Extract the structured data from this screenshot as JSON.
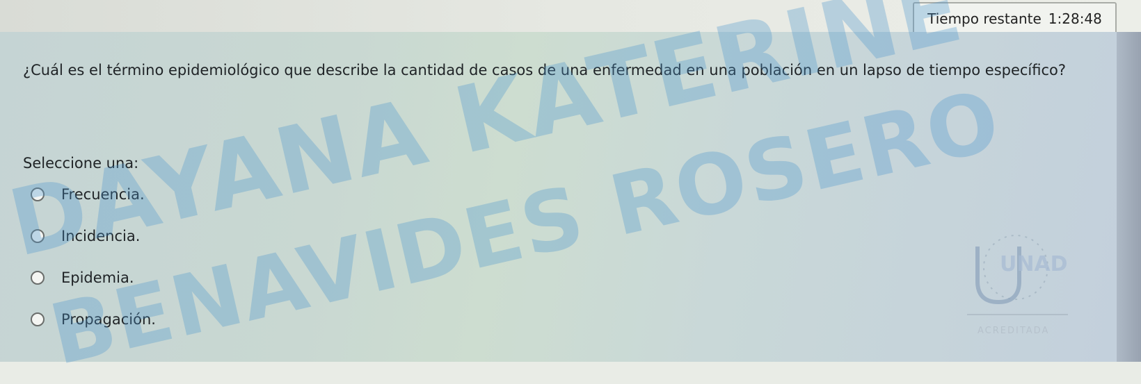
{
  "timer": {
    "label": "Tiempo restante",
    "value": "1:28:48"
  },
  "question": {
    "text": "¿Cuál es el término epidemiológico que describe la cantidad de casos de una enfermedad en una población en un lapso de tiempo específico?"
  },
  "prompt": "Seleccione una:",
  "options": [
    {
      "label": "Frecuencia."
    },
    {
      "label": "Incidencia."
    },
    {
      "label": "Epidemia."
    },
    {
      "label": "Propagación."
    }
  ],
  "watermark": {
    "line1": "DAYANA KATERINE",
    "line2": "BENAVIDES ROSERO"
  },
  "logo": {
    "text": "UNAD",
    "accreditation": "ACREDITADA"
  },
  "colors": {
    "watermark": "#4b96cd",
    "panel": "#c9d8d2",
    "radio_border": "#6a6d6b"
  },
  "icons": {
    "radio": "radio-button-unchecked-icon",
    "logo": "unad-logo-icon"
  }
}
